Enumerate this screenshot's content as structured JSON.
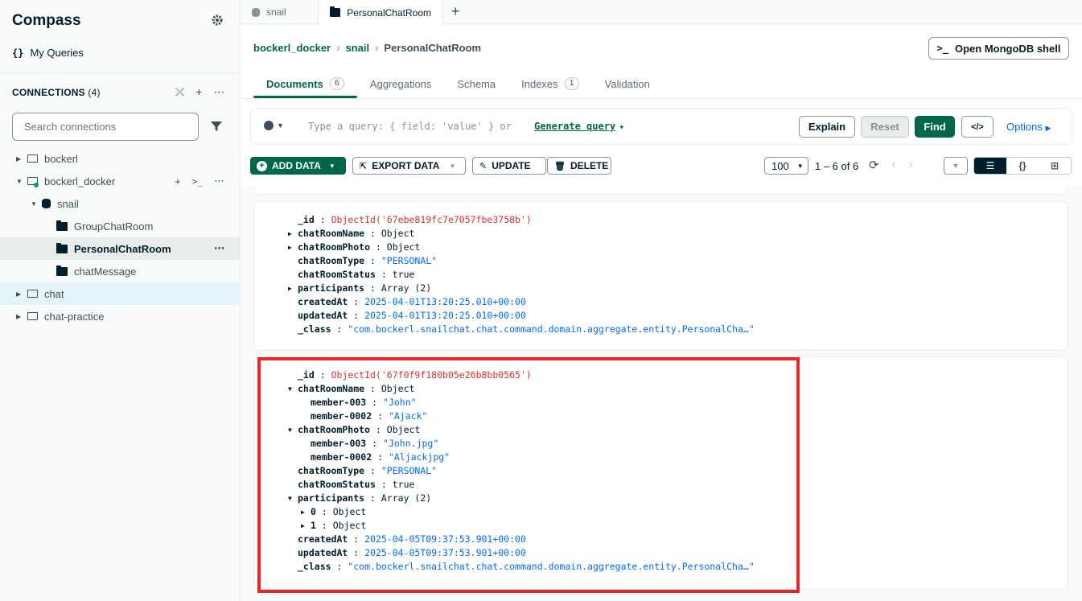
{
  "app": {
    "title": "Compass"
  },
  "sidebar": {
    "my_queries": "My Queries",
    "connections_label": "CONNECTIONS",
    "connections_count": "(4)",
    "search_placeholder": "Search connections",
    "tree": [
      {
        "label": "bockerl",
        "level": 0,
        "type": "connection",
        "expanded": false
      },
      {
        "label": "bockerl_docker",
        "level": 0,
        "type": "connection",
        "expanded": true,
        "connected": true
      },
      {
        "label": "snail",
        "level": 1,
        "type": "database",
        "expanded": true
      },
      {
        "label": "GroupChatRoom",
        "level": 2,
        "type": "collection"
      },
      {
        "label": "PersonalChatRoom",
        "level": 2,
        "type": "collection",
        "selected": true
      },
      {
        "label": "chatMessage",
        "level": 2,
        "type": "collection"
      },
      {
        "label": "chat",
        "level": 0,
        "type": "connection",
        "expanded": false,
        "active": true
      },
      {
        "label": "chat-practice",
        "level": 0,
        "type": "connection",
        "expanded": false
      }
    ]
  },
  "tabs": [
    {
      "label": "snail",
      "icon": "database-icon",
      "active": false
    },
    {
      "label": "PersonalChatRoom",
      "icon": "folder-icon",
      "active": true
    }
  ],
  "breadcrumb": {
    "connection": "bockerl_docker",
    "database": "snail",
    "collection": "PersonalChatRoom"
  },
  "shell_button": "Open MongoDB shell",
  "subtabs": [
    {
      "label": "Documents",
      "badge": "6",
      "active": true
    },
    {
      "label": "Aggregations",
      "badge": ""
    },
    {
      "label": "Schema",
      "badge": ""
    },
    {
      "label": "Indexes",
      "badge": "1"
    },
    {
      "label": "Validation",
      "badge": ""
    }
  ],
  "query": {
    "placeholder": "Type a query: { field: 'value' } or",
    "generate": "Generate query",
    "explain": "Explain",
    "reset": "Reset",
    "find": "Find",
    "options": "Options"
  },
  "toolbar": {
    "add_data": "ADD DATA",
    "export_data": "EXPORT DATA",
    "update": "UPDATE",
    "delete": "DELETE",
    "page_size": "100",
    "range": "1 – 6 of 6"
  },
  "documents": [
    {
      "fields": [
        {
          "key": "_id",
          "value": "ObjectId('67ebe819fc7e7057fbe3758b')",
          "kind": "oid",
          "indent": 0
        },
        {
          "key": "chatRoomName",
          "value": "Object",
          "kind": "plain",
          "indent": 0,
          "toggle": "collapsed"
        },
        {
          "key": "chatRoomPhoto",
          "value": "Object",
          "kind": "plain",
          "indent": 0,
          "toggle": "collapsed"
        },
        {
          "key": "chatRoomType",
          "value": "\"PERSONAL\"",
          "kind": "str",
          "indent": 0
        },
        {
          "key": "chatRoomStatus",
          "value": "true",
          "kind": "plain",
          "indent": 0
        },
        {
          "key": "participants",
          "value": "Array (2)",
          "kind": "plain",
          "indent": 0,
          "toggle": "collapsed"
        },
        {
          "key": "createdAt",
          "value": "2025-04-01T13:20:25.010+00:00",
          "kind": "num",
          "indent": 0
        },
        {
          "key": "updatedAt",
          "value": "2025-04-01T13:20:25.010+00:00",
          "kind": "num",
          "indent": 0
        },
        {
          "key": "_class",
          "value": "\"com.bockerl.snailchat.chat.command.domain.aggregate.entity.PersonalCha…\"",
          "kind": "str",
          "indent": 0
        }
      ]
    },
    {
      "fields": [
        {
          "key": "_id",
          "value": "ObjectId('67f0f9f180b05e26b8bb0565')",
          "kind": "oid",
          "indent": 0
        },
        {
          "key": "chatRoomName",
          "value": "Object",
          "kind": "plain",
          "indent": 0,
          "toggle": "expanded"
        },
        {
          "key": "member-003",
          "value": "\"John\"",
          "kind": "str",
          "indent": 1
        },
        {
          "key": "member-0002",
          "value": "\"Ajack\"",
          "kind": "str",
          "indent": 1
        },
        {
          "key": "chatRoomPhoto",
          "value": "Object",
          "kind": "plain",
          "indent": 0,
          "toggle": "expanded"
        },
        {
          "key": "member-003",
          "value": "\"John.jpg\"",
          "kind": "str",
          "indent": 1
        },
        {
          "key": "member-0002",
          "value": "\"Aljackjpg\"",
          "kind": "str",
          "indent": 1
        },
        {
          "key": "chatRoomType",
          "value": "\"PERSONAL\"",
          "kind": "str",
          "indent": 0
        },
        {
          "key": "chatRoomStatus",
          "value": "true",
          "kind": "plain",
          "indent": 0
        },
        {
          "key": "participants",
          "value": "Array (2)",
          "kind": "plain",
          "indent": 0,
          "toggle": "expanded"
        },
        {
          "key": "0",
          "value": "Object",
          "kind": "plain",
          "indent": 1,
          "toggle": "collapsed"
        },
        {
          "key": "1",
          "value": "Object",
          "kind": "plain",
          "indent": 1,
          "toggle": "collapsed"
        },
        {
          "key": "createdAt",
          "value": "2025-04-05T09:37:53.901+00:00",
          "kind": "num",
          "indent": 0
        },
        {
          "key": "updatedAt",
          "value": "2025-04-05T09:37:53.901+00:00",
          "kind": "num",
          "indent": 0
        },
        {
          "key": "_class",
          "value": "\"com.bockerl.snailchat.chat.command.domain.aggregate.entity.PersonalCha…\"",
          "kind": "str",
          "indent": 0
        }
      ]
    }
  ],
  "colors": {
    "accent": "#00684a",
    "highlight": "#e7262a",
    "oid": "#db3030",
    "value": "#016bf8"
  }
}
